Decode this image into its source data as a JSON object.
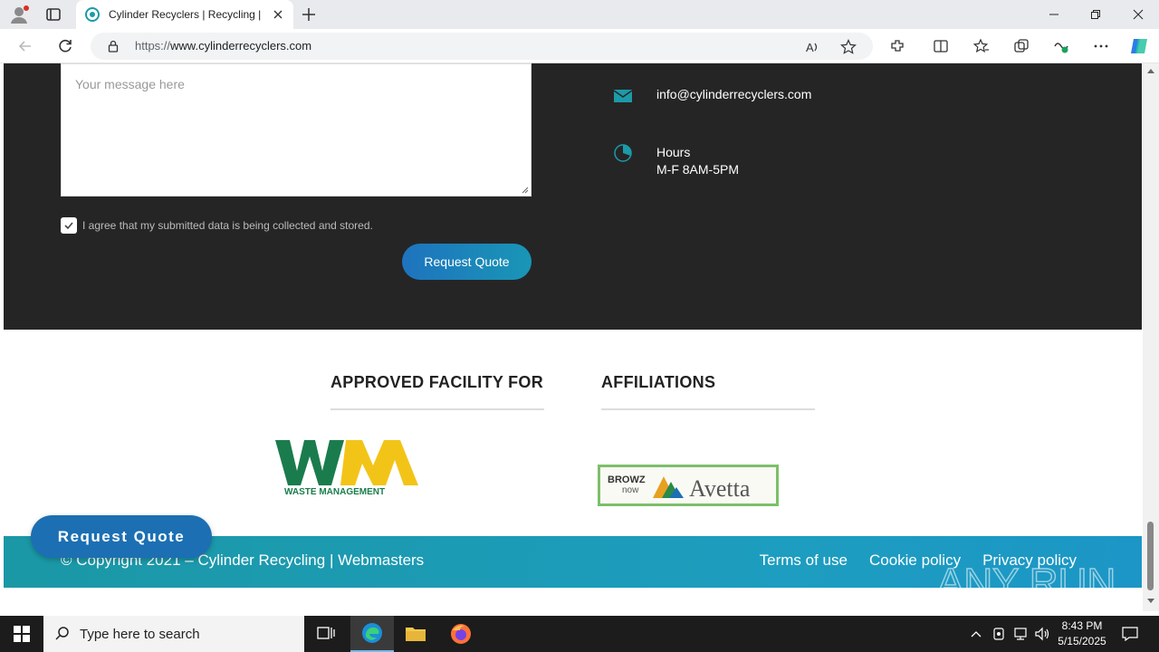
{
  "browser": {
    "tab_title": "Cylinder Recyclers | Recycling | D",
    "url_prefix": "https://",
    "url_domain": "www.cylinderrecyclers.com"
  },
  "form": {
    "message_placeholder": "Your message here",
    "agree_text": "I agree that my submitted data is being collected and stored.",
    "agree_checked": true,
    "submit_label": "Request Quote"
  },
  "contact": {
    "email": "info@cylinderrecyclers.com",
    "hours_label": "Hours",
    "hours_value": "M-F 8AM-5PM"
  },
  "sections": {
    "approved_heading": "APPROVED FACILITY FOR",
    "affiliations_heading": "AFFILIATIONS",
    "wm_logo_text": "WASTE MANAGEMENT",
    "browz_text": "BROWZ",
    "now_text": "now",
    "avetta_text": "Avetta"
  },
  "footer": {
    "copyright": "© Copyright 2021 – Cylinder Recycling | Webmasters",
    "links": [
      "Terms of use",
      "Cookie policy",
      "Privacy policy"
    ]
  },
  "floating_button": "Request Quote",
  "watermark": "ANY RUN",
  "taskbar": {
    "search_placeholder": "Type here to search",
    "time": "8:43 PM",
    "date": "5/15/2025"
  },
  "colors": {
    "dark_bg": "#252526",
    "accent_teal": "#1c9aa8",
    "button_blue": "#1e73be"
  }
}
